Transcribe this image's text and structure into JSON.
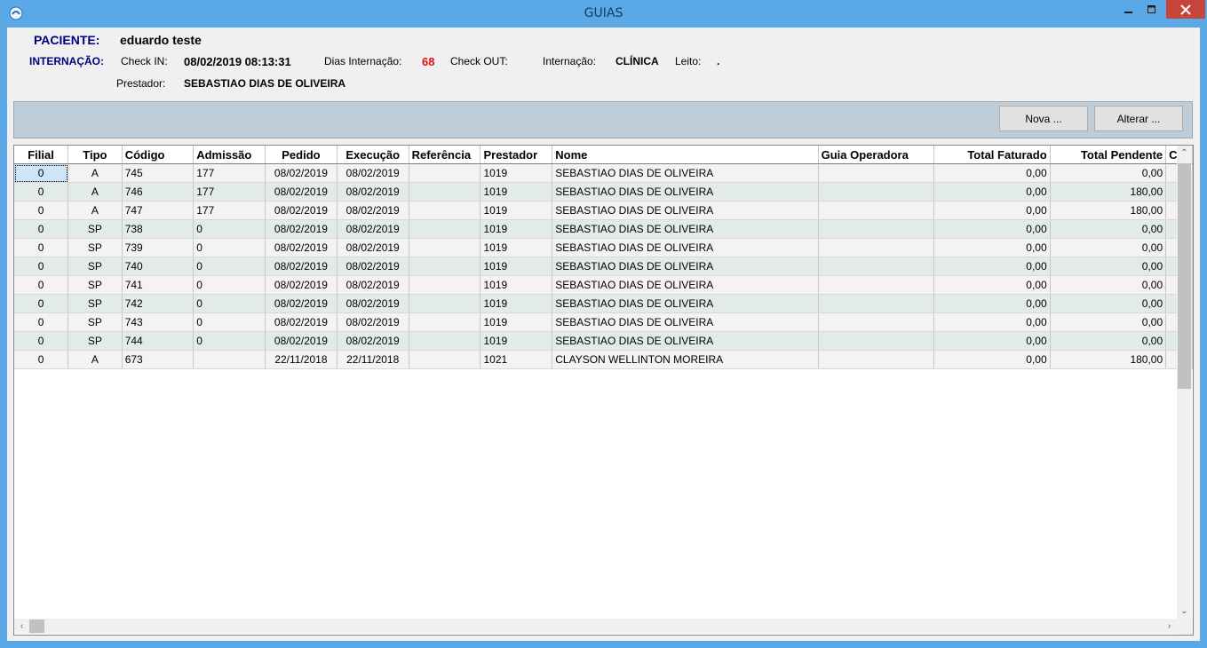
{
  "window": {
    "title": "GUIAS"
  },
  "patient": {
    "label": "PACIENTE:",
    "name": "eduardo teste",
    "internacao_label": "INTERNAÇÃO:",
    "checkin_label": "Check IN:",
    "checkin_value": "08/02/2019 08:13:31",
    "dias_label": "Dias Internação:",
    "dias_value": "68",
    "checkout_label": "Check OUT:",
    "internacao_tipo_label": "Internação:",
    "internacao_tipo_value": "CLÍNICA",
    "leito_label": "Leito:",
    "leito_value": ".",
    "prestador_label": "Prestador:",
    "prestador_value": "SEBASTIAO DIAS DE OLIVEIRA"
  },
  "toolbar": {
    "nova_label": "Nova ...",
    "alterar_label": "Alterar ..."
  },
  "grid": {
    "columns": [
      "Filial",
      "Tipo",
      "Código",
      "Admissão",
      "Pedido",
      "Execução",
      "Referência",
      "Prestador",
      "Nome",
      "Guia Operadora",
      "Total Faturado",
      "Total Pendente",
      "C"
    ],
    "rows": [
      [
        "0",
        "A",
        "745",
        "177",
        "08/02/2019",
        "08/02/2019",
        "",
        "1019",
        "SEBASTIAO DIAS DE OLIVEIRA",
        "",
        "0,00",
        "0,00"
      ],
      [
        "0",
        "A",
        "746",
        "177",
        "08/02/2019",
        "08/02/2019",
        "",
        "1019",
        "SEBASTIAO DIAS DE OLIVEIRA",
        "",
        "0,00",
        "180,00"
      ],
      [
        "0",
        "A",
        "747",
        "177",
        "08/02/2019",
        "08/02/2019",
        "",
        "1019",
        "SEBASTIAO DIAS DE OLIVEIRA",
        "",
        "0,00",
        "180,00"
      ],
      [
        "0",
        "SP",
        "738",
        "0",
        "08/02/2019",
        "08/02/2019",
        "",
        "1019",
        "SEBASTIAO DIAS DE OLIVEIRA",
        "",
        "0,00",
        "0,00"
      ],
      [
        "0",
        "SP",
        "739",
        "0",
        "08/02/2019",
        "08/02/2019",
        "",
        "1019",
        "SEBASTIAO DIAS DE OLIVEIRA",
        "",
        "0,00",
        "0,00"
      ],
      [
        "0",
        "SP",
        "740",
        "0",
        "08/02/2019",
        "08/02/2019",
        "",
        "1019",
        "SEBASTIAO DIAS DE OLIVEIRA",
        "",
        "0,00",
        "0,00"
      ],
      [
        "0",
        "SP",
        "741",
        "0",
        "08/02/2019",
        "08/02/2019",
        "",
        "1019",
        "SEBASTIAO DIAS DE OLIVEIRA",
        "",
        "0,00",
        "0,00"
      ],
      [
        "0",
        "SP",
        "742",
        "0",
        "08/02/2019",
        "08/02/2019",
        "",
        "1019",
        "SEBASTIAO DIAS DE OLIVEIRA",
        "",
        "0,00",
        "0,00"
      ],
      [
        "0",
        "SP",
        "743",
        "0",
        "08/02/2019",
        "08/02/2019",
        "",
        "1019",
        "SEBASTIAO DIAS DE OLIVEIRA",
        "",
        "0,00",
        "0,00"
      ],
      [
        "0",
        "SP",
        "744",
        "0",
        "08/02/2019",
        "08/02/2019",
        "",
        "1019",
        "SEBASTIAO DIAS DE OLIVEIRA",
        "",
        "0,00",
        "0,00"
      ],
      [
        "0",
        "A",
        "673",
        "",
        "22/11/2018",
        "22/11/2018",
        "",
        "1021",
        "CLAYSON WELLINTON MOREIRA",
        "",
        "0,00",
        "180,00"
      ]
    ]
  },
  "colors": {
    "titlebar": "#5aa9e6",
    "close": "#c7443a",
    "row_odd": "#f4f2f2",
    "row_even": "#e2ebe6",
    "label_navy": "#000080",
    "dias_red": "#e01010"
  }
}
